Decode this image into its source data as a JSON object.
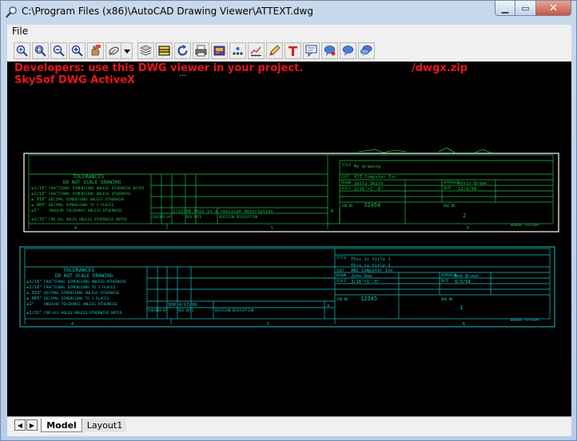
{
  "window": {
    "title": "C:\\Program Files (x86)\\AutoCAD Drawing Viewer\\ATTEXT.dwg",
    "minimize_glyph": "▁",
    "maximize_glyph": "▭",
    "close_glyph": "✕"
  },
  "menu": {
    "file_label": "File"
  },
  "toolbar": {
    "icons": [
      "zoom-fit-icon",
      "zoom-window-icon",
      "zoom-out-icon",
      "zoom-in-icon",
      "pan-icon",
      "orbit-icon",
      "dropdown-arrow-icon",
      "layers-icon",
      "layout-icon",
      "refresh-icon",
      "print-icon",
      "image-icon",
      "points-icon",
      "measure-icon",
      "pencil-icon",
      "text-icon",
      "comment-icon",
      "comment-add-icon",
      "comment-chat-icon",
      "comment-multi-icon"
    ]
  },
  "canvas": {
    "banner_line1": "Developers: use this DWG viewer in your project.",
    "banner_link": "/dwgx.zip",
    "banner_line2": "SkySof DWG ActiveX",
    "banner_dots": "...",
    "drawing_top": {
      "tolerances_title": "TOLERANCES",
      "do_not_scale": "DO NOT SCALE DRAWING",
      "tol_rows": [
        {
          "val": "±1/16\"",
          "desc": "FRACTIONAL DIMENSIONS UNLESS OTHERWISE NOTED"
        },
        {
          "val": "±1/16\"",
          "desc": "FRACTIONAL DIMENSIONS UNLESS OTHERWISE"
        },
        {
          "val": "±.010\"",
          "desc": "DECIMAL DIMENSIONS UNLESS OTHERWISE"
        },
        {
          "val": "±.005\"",
          "desc": "DECIMAL DIMENSIONS TO 3 PLACES"
        },
        {
          "val": "±1°",
          "desc": "ANGULAR TOLERANCE UNLESS OTHERWISE"
        },
        {
          "val": "±1/32\"",
          "desc": "FOR ALL HOLES UNLESS OTHERWISE NOTED"
        }
      ],
      "rev_entry": "2/17/98 This is a revision description",
      "rev_letter": "B",
      "checked_label": "CHECKED BY",
      "rev_date_label": "REV DATE",
      "rev_desc_label": "REVISION DESCRIPTION",
      "title_label": "TITLE",
      "title_value": "My drawing",
      "customer_label": "CUST",
      "customer_value": "XYZ Computer Inc",
      "drawn_label": "DRAWN",
      "drawn_value": "Sally Smith",
      "scale_label": "SCALE",
      "scale_value": "3/16\"=1'-0\"",
      "approved_label": "APPROVED",
      "approved_value": "Kevin Brown",
      "date_label": "DATE",
      "date_value": "12/9/98",
      "job_label": "JOB NO.",
      "job_value": "32454",
      "dwg_label": "DWG NO.",
      "dwg_value": "2",
      "col_markers": [
        "4",
        "5",
        "6"
      ],
      "border_note": "BORDER (SYSTEM)"
    },
    "drawing_bottom": {
      "tolerances_title": "TOLERANCES",
      "do_not_scale": "DO NOT SCALE DRAWING",
      "tol_rows": [
        {
          "val": "±1/16\"",
          "desc": "FRACTIONAL DIMENSIONS UNLESS OTHERWISE"
        },
        {
          "val": "±1/16\"",
          "desc": "FRACTIONAL DIMENSIONS TO 3 PLACES"
        },
        {
          "val": "±.010\"",
          "desc": "DECIMAL DIMENSIONS UNLESS OTHERWISE"
        },
        {
          "val": "±.005\"",
          "desc": "DECIMAL DIMENSIONS TO 3 PLACES"
        },
        {
          "val": "±1°",
          "desc": "ANGULAR TOLERANCE UNLESS OTHERWISE"
        },
        {
          "val": "±1/32\"",
          "desc": "FOR ALL HOLES UNLESS OTHERWISE NOTED"
        }
      ],
      "rev_entry": "SHH 4/17/99",
      "rev_letter": "a",
      "checked_label": "CHECKED BY",
      "rev_date_label": "REV DATE",
      "rev_desc_label": "REVISION DESCRIPTION",
      "title_label": "TITLE",
      "title_line1": "This is title 1",
      "title_line2": "This is title 2",
      "customer_label": "CUST",
      "customer_value": "ABC Computer Inc",
      "drawn_label": "DRAWN",
      "drawn_value": "John Doe",
      "scale_label": "SCALE",
      "scale_value": "3/16\"=1'-0\"",
      "approved_label": "APPROVED",
      "approved_value": "Bob Brown",
      "date_label": "DATE",
      "date_value": "8/9/98",
      "job_label": "JOB NO.",
      "job_value": "12345",
      "dwg_label": "DWG NO.",
      "dwg_value": "1",
      "col_markers": [
        "4",
        "5",
        "6"
      ],
      "border_note": "BORDER (SYSTEM)"
    }
  },
  "tabs": {
    "model": "Model",
    "layout1": "Layout1",
    "prev_glyph": "◀",
    "next_glyph": "▶"
  },
  "colors": {
    "canvas_bg": "#000000",
    "banner": "#e8141c",
    "drawing_green": "#1fbf4a",
    "drawing_cyan": "#18c4c4"
  }
}
